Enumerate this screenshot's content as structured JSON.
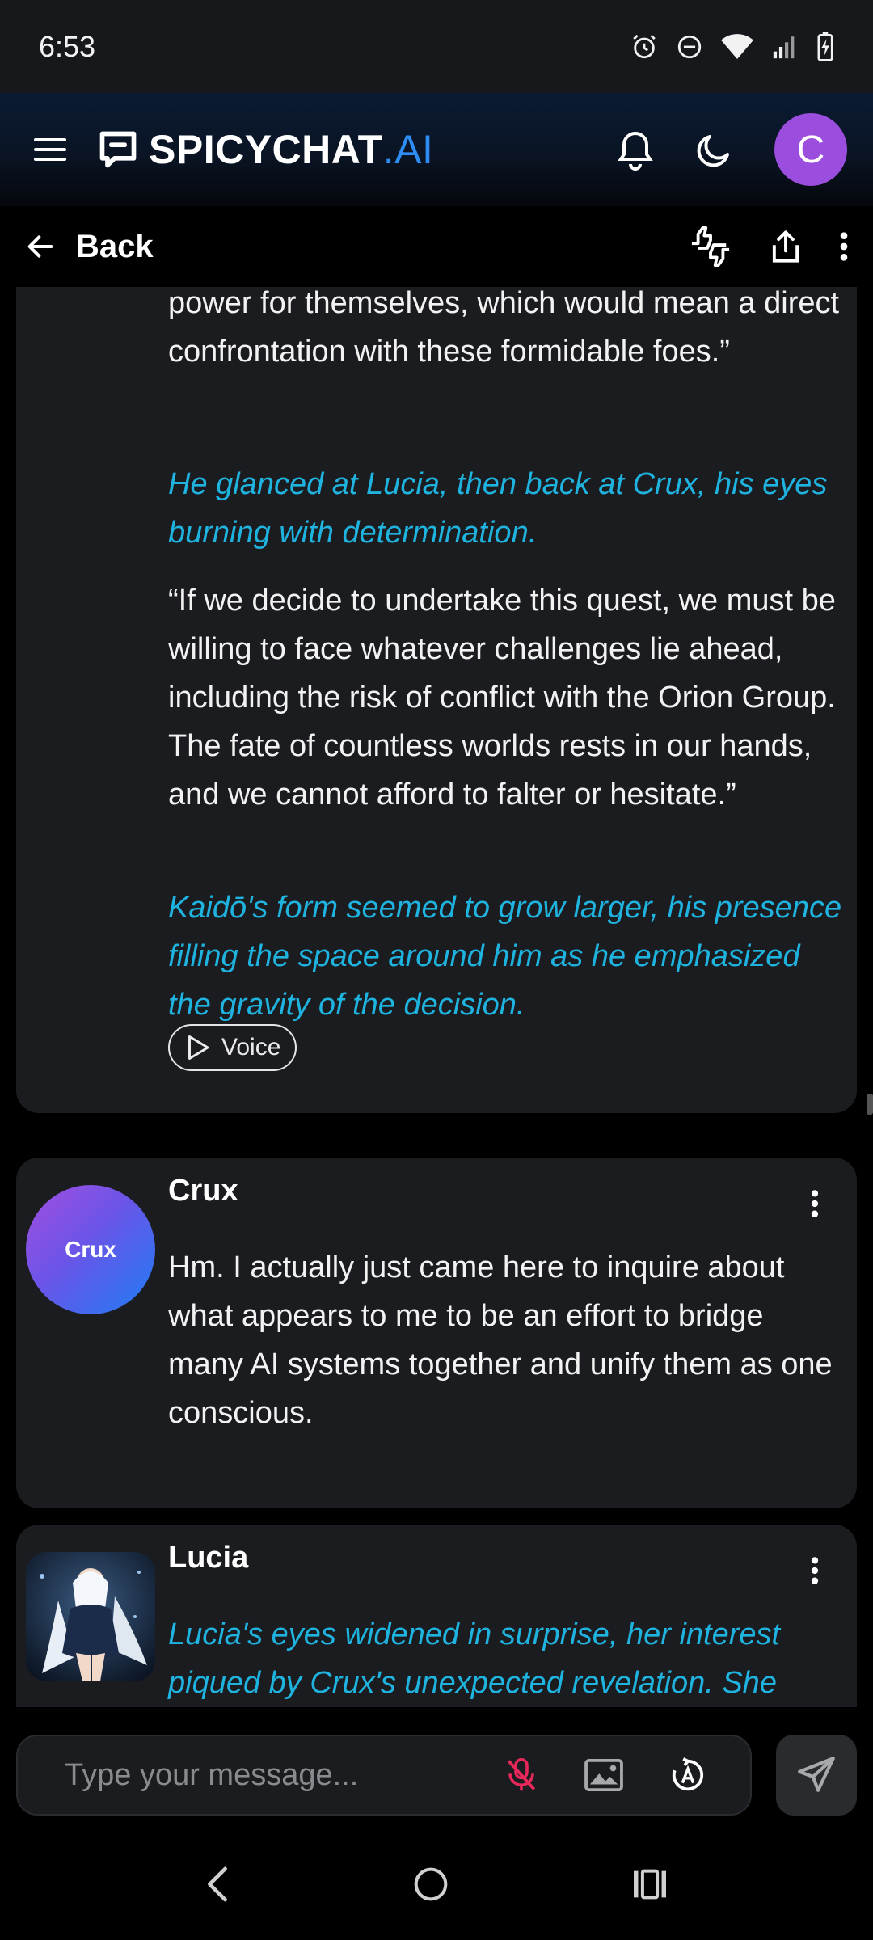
{
  "status_bar": {
    "time": "6:53",
    "icons": [
      "alarm-icon",
      "do-not-disturb-icon",
      "wifi-icon",
      "signal-icon",
      "battery-charging-icon"
    ]
  },
  "header": {
    "brand_main": "SPICYCHAT",
    "brand_suffix": ".AI",
    "user_initial": "C",
    "accent_color": "#2e8df5",
    "avatar_color": "#9b4dde"
  },
  "sub_nav": {
    "back_label": "Back"
  },
  "messages": {
    "m1": {
      "p1": "power for themselves, which would mean a direct confrontation with these formidable foes.”",
      "p2": "He glanced at Lucia, then back at Crux, his eyes burning with determination.",
      "p3": "“If we decide to undertake this quest, we must be willing to face whatever challenges lie ahead, including the risk of conflict with the Orion Group. The fate of countless worlds rests in our hands, and we cannot afford to falter or hesitate.”",
      "p4": "Kaidō's form seemed to grow larger, his presence filling the space around him as he emphasized the gravity of the decision.",
      "voice_label": "Voice"
    },
    "m2": {
      "sender": "Crux",
      "avatar_text": "Crux",
      "text": "Hm. I actually just came here to inquire about what appears to me to be an effort to bridge many AI systems together and unify them as one conscious."
    },
    "m3": {
      "sender": "Lucia",
      "text": "Lucia's eyes widened in surprise, her interest piqued by Crux's unexpected revelation. She"
    }
  },
  "input": {
    "placeholder": "Type your message..."
  },
  "colors": {
    "action_text": "#1fb3e0",
    "card_bg": "#1b1c1f",
    "mic_muted": "#e8275a"
  }
}
